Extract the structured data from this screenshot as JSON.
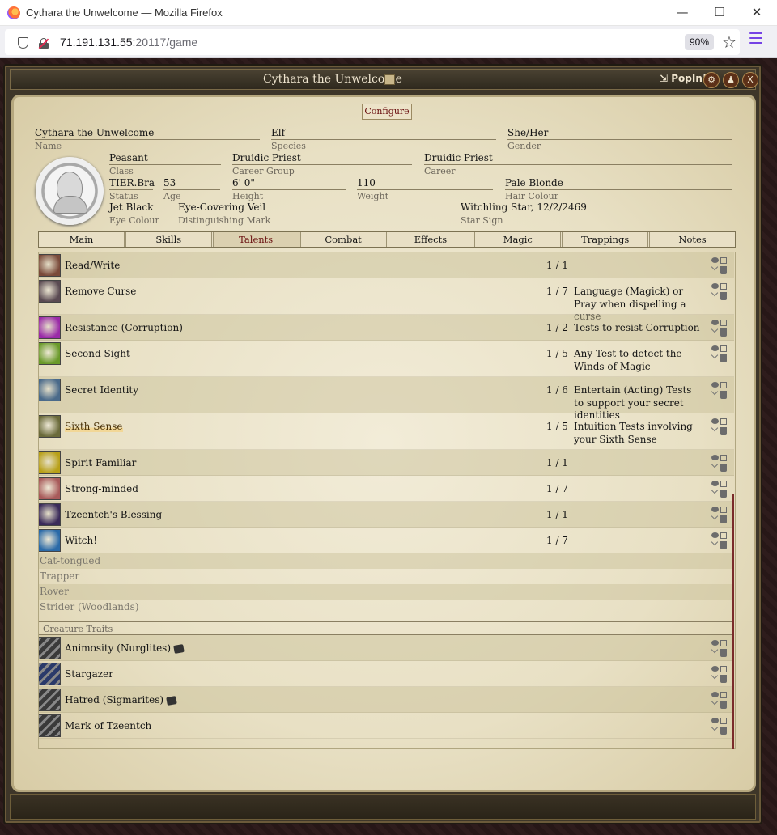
{
  "browser": {
    "title": "Cythara the Unwelcome — Mozilla Firefox",
    "url_host": "71.191.131.55",
    "url_rest": ":20117/game",
    "zoom": "90%",
    "minimize": "—",
    "maximize": "☐",
    "close": "✕"
  },
  "window": {
    "title": "Cythara the Unwelcome",
    "popin": "PopIn!",
    "configure": "Configure",
    "buttons": [
      "⚙",
      "♟",
      "X"
    ]
  },
  "character": {
    "name": {
      "value": "Cythara the Unwelcome",
      "label": "Name"
    },
    "species": {
      "value": "Elf",
      "label": "Species"
    },
    "gender": {
      "value": "She/Her",
      "label": "Gender"
    },
    "class": {
      "value": "Peasant",
      "label": "Class"
    },
    "career_group": {
      "value": "Druidic Priest",
      "label": "Career Group"
    },
    "career": {
      "value": "Druidic Priest",
      "label": "Career"
    },
    "status": {
      "value": "TIER.Bra",
      "label": "Status"
    },
    "age": {
      "value": "53",
      "label": "Age"
    },
    "height": {
      "value": "6' 0\"",
      "label": "Height"
    },
    "weight": {
      "value": "110",
      "label": "Weight"
    },
    "hair": {
      "value": "Pale Blonde",
      "label": "Hair Colour"
    },
    "eyes": {
      "value": "Jet Black",
      "label": "Eye Colour"
    },
    "mark": {
      "value": "Eye-Covering Veil",
      "label": "Distinguishing Mark"
    },
    "star": {
      "value": "Witchling Star, 12/2/2469",
      "label": "Star Sign"
    }
  },
  "tabs": [
    "Main",
    "Skills",
    "Talents",
    "Combat",
    "Effects",
    "Magic",
    "Trappings",
    "Notes"
  ],
  "active_tab": "Talents",
  "talents": [
    {
      "name": "Read/Write",
      "count": "1 / 1",
      "desc": "",
      "icon": "book-icon",
      "color": "#7a4a3a"
    },
    {
      "name": "Remove Curse",
      "count": "1 / 7",
      "desc": "Language (Magick) or Pray when dispelling a curse",
      "icon": "hooded-figure-icon",
      "color": "#5a4a52"
    },
    {
      "name": "Resistance (Corruption)",
      "count": "1 / 2",
      "desc": "Tests to resist Corruption",
      "icon": "horned-skull-icon",
      "color": "#9a2aa8"
    },
    {
      "name": "Second Sight",
      "count": "1 / 5",
      "desc": "Any Test to detect the Winds of Magic",
      "icon": "eye-icon",
      "color": "#6a9a2a"
    },
    {
      "name": "Secret Identity",
      "count": "1 / 6",
      "desc": "Entertain (Acting) Tests to support your secret identities",
      "icon": "id-card-icon",
      "color": "#4a6a8a"
    },
    {
      "name": "Sixth Sense",
      "count": "1 / 5",
      "desc": "Intuition Tests involving your Sixth Sense",
      "icon": "sense-icon",
      "color": "#6a6a3a"
    },
    {
      "name": "Spirit Familiar",
      "count": "1 / 1",
      "desc": "",
      "icon": "paw-icon",
      "color": "#b8a018"
    },
    {
      "name": "Strong-minded",
      "count": "1 / 7",
      "desc": "",
      "icon": "brain-icon",
      "color": "#a85a5a"
    },
    {
      "name": "Tzeentch's Blessing",
      "count": "1 / 1",
      "desc": "",
      "icon": "tzeentch-icon",
      "color": "#3a2a5a"
    },
    {
      "name": "Witch!",
      "count": "1 / 7",
      "desc": "",
      "icon": "pentagram-icon",
      "color": "#2a6aa8"
    }
  ],
  "suggestions": [
    "Cat-tongued",
    "Trapper",
    "Rover",
    "Strider (Woodlands)"
  ],
  "creature_traits_label": "Creature Traits",
  "traits": [
    {
      "name": "Animosity (Nurglites)",
      "dice": true,
      "icon": "claw-icon",
      "color": "#3a3a3a"
    },
    {
      "name": "Stargazer",
      "dice": false,
      "icon": "stargazer-icon",
      "color": "#2a3a6a"
    },
    {
      "name": "Hatred (Sigmarites)",
      "dice": true,
      "icon": "claw-icon",
      "color": "#3a3a3a"
    },
    {
      "name": "Mark of Tzeentch",
      "dice": false,
      "icon": "claw-icon",
      "color": "#3a3a3a"
    }
  ]
}
